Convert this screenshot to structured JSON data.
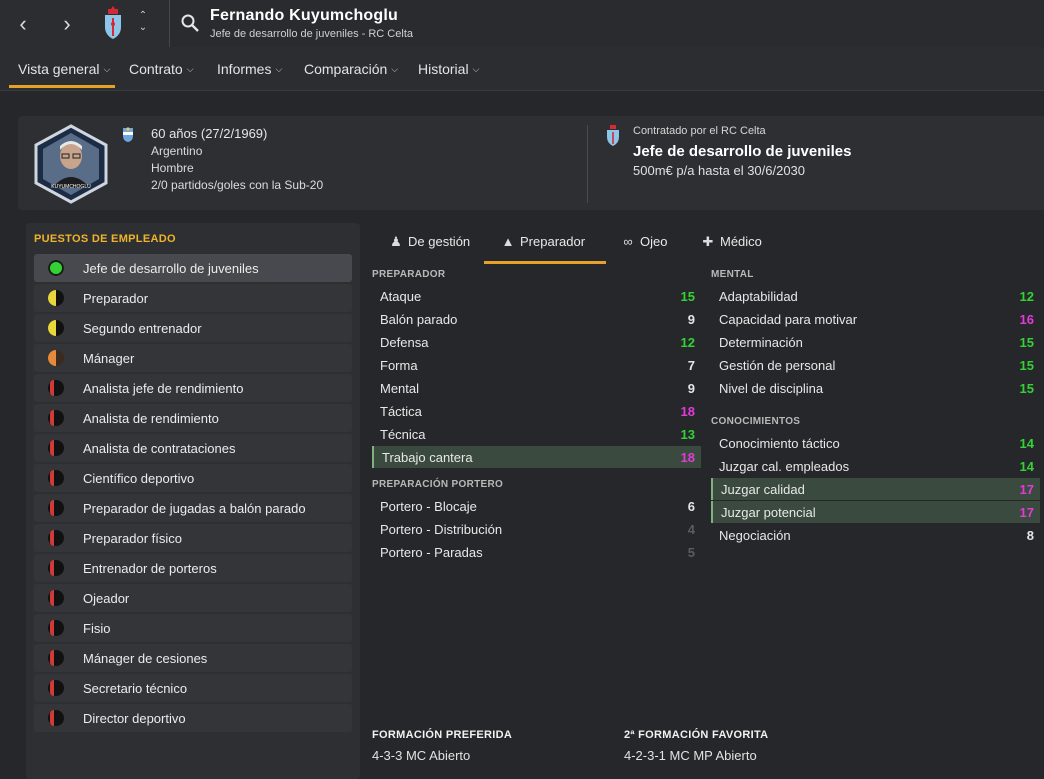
{
  "header": {
    "name": "Fernando Kuyumchoglu",
    "role": "Jefe de desarrollo de juveniles - RC Celta"
  },
  "menu": [
    {
      "label": "Vista general"
    },
    {
      "label": "Contrato"
    },
    {
      "label": "Informes"
    },
    {
      "label": "Comparación"
    },
    {
      "label": "Historial"
    }
  ],
  "profile": {
    "age": "60 años (27/2/1969)",
    "nationality": "Argentino",
    "gender": "Hombre",
    "caps": "2/0 partidos/goles con la Sub-20",
    "avatar_caption": "KUYUMCHOGLU",
    "contract_by": "Contratado por el RC Celta",
    "contract_role": "Jefe de desarrollo de juveniles",
    "contract_wage": "500m€ p/a hasta el 30/6/2030"
  },
  "roles": {
    "title": "PUESTOS DE EMPLEADO",
    "items": [
      {
        "label": "Jefe de desarrollo de juveniles",
        "status": "green"
      },
      {
        "label": "Preparador",
        "status": "yellow"
      },
      {
        "label": "Segundo entrenador",
        "status": "yellow"
      },
      {
        "label": "Mánager",
        "status": "orange"
      },
      {
        "label": "Analista jefe de rendimiento",
        "status": "red"
      },
      {
        "label": "Analista de rendimiento",
        "status": "red"
      },
      {
        "label": "Analista de contrataciones",
        "status": "red"
      },
      {
        "label": "Científico deportivo",
        "status": "red"
      },
      {
        "label": "Preparador de jugadas a balón parado",
        "status": "red"
      },
      {
        "label": "Preparador físico",
        "status": "red"
      },
      {
        "label": "Entrenador de porteros",
        "status": "red"
      },
      {
        "label": "Ojeador",
        "status": "red"
      },
      {
        "label": "Fisio",
        "status": "red"
      },
      {
        "label": "Mánager de cesiones",
        "status": "red"
      },
      {
        "label": "Secretario técnico",
        "status": "red"
      },
      {
        "label": "Director deportivo",
        "status": "red"
      }
    ]
  },
  "attr_tabs": [
    {
      "label": "De gestión",
      "icon": "manager-icon"
    },
    {
      "label": "Preparador",
      "icon": "coach-icon"
    },
    {
      "label": "Ojeo",
      "icon": "binoculars-icon"
    },
    {
      "label": "Médico",
      "icon": "medical-kit-icon"
    }
  ],
  "sections": {
    "preparador": {
      "title": "PREPARADOR",
      "rows": [
        {
          "name": "Ataque",
          "value": "15",
          "color": "green"
        },
        {
          "name": "Balón parado",
          "value": "9",
          "color": "white"
        },
        {
          "name": "Defensa",
          "value": "12",
          "color": "green"
        },
        {
          "name": "Forma",
          "value": "7",
          "color": "white"
        },
        {
          "name": "Mental",
          "value": "9",
          "color": "white"
        },
        {
          "name": "Táctica",
          "value": "18",
          "color": "pink"
        },
        {
          "name": "Técnica",
          "value": "13",
          "color": "green"
        },
        {
          "name": "Trabajo cantera",
          "value": "18",
          "color": "pink",
          "highlight": true
        }
      ]
    },
    "portero": {
      "title": "PREPARACIÓN PORTERO",
      "rows": [
        {
          "name": "Portero - Blocaje",
          "value": "6",
          "color": "white"
        },
        {
          "name": "Portero - Distribución",
          "value": "4",
          "color": "grey"
        },
        {
          "name": "Portero - Paradas",
          "value": "5",
          "color": "grey"
        }
      ]
    },
    "mental": {
      "title": "MENTAL",
      "rows": [
        {
          "name": "Adaptabilidad",
          "value": "12",
          "color": "green"
        },
        {
          "name": "Capacidad para motivar",
          "value": "16",
          "color": "pink"
        },
        {
          "name": "Determinación",
          "value": "15",
          "color": "green"
        },
        {
          "name": "Gestión de personal",
          "value": "15",
          "color": "green"
        },
        {
          "name": "Nivel de disciplina",
          "value": "15",
          "color": "green"
        }
      ]
    },
    "conocimientos": {
      "title": "CONOCIMIENTOS",
      "rows": [
        {
          "name": "Conocimiento táctico",
          "value": "14",
          "color": "green"
        },
        {
          "name": "Juzgar cal. empleados",
          "value": "14",
          "color": "green"
        },
        {
          "name": "Juzgar calidad",
          "value": "17",
          "color": "pink",
          "highlight": true
        },
        {
          "name": "Juzgar potencial",
          "value": "17",
          "color": "pink",
          "highlight": true
        },
        {
          "name": "Negociación",
          "value": "8",
          "color": "white"
        }
      ]
    }
  },
  "formations": {
    "preferred_title": "FORMACIÓN PREFERIDA",
    "preferred_value": "4-3-3 MC Abierto",
    "second_title": "2ª FORMACIÓN FAVORITA",
    "second_value": "4-2-3-1 MC MP Abierto"
  },
  "colors": {
    "accent": "#e5a12a",
    "green": "#34d234",
    "pink": "#e23bd8",
    "celta_blue": "#8ec6ea",
    "celta_red": "#d42a35"
  }
}
